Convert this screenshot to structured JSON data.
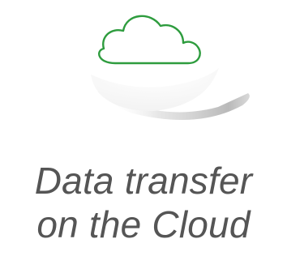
{
  "feature": {
    "icon": "cloud-icon",
    "caption_line1": "Data transfer",
    "caption_line2": "on the Cloud"
  },
  "colors": {
    "icon_stroke": "#2e9c3e",
    "caption_text": "#555555",
    "background": "#ffffff",
    "shadow": "#bdbdbd"
  }
}
